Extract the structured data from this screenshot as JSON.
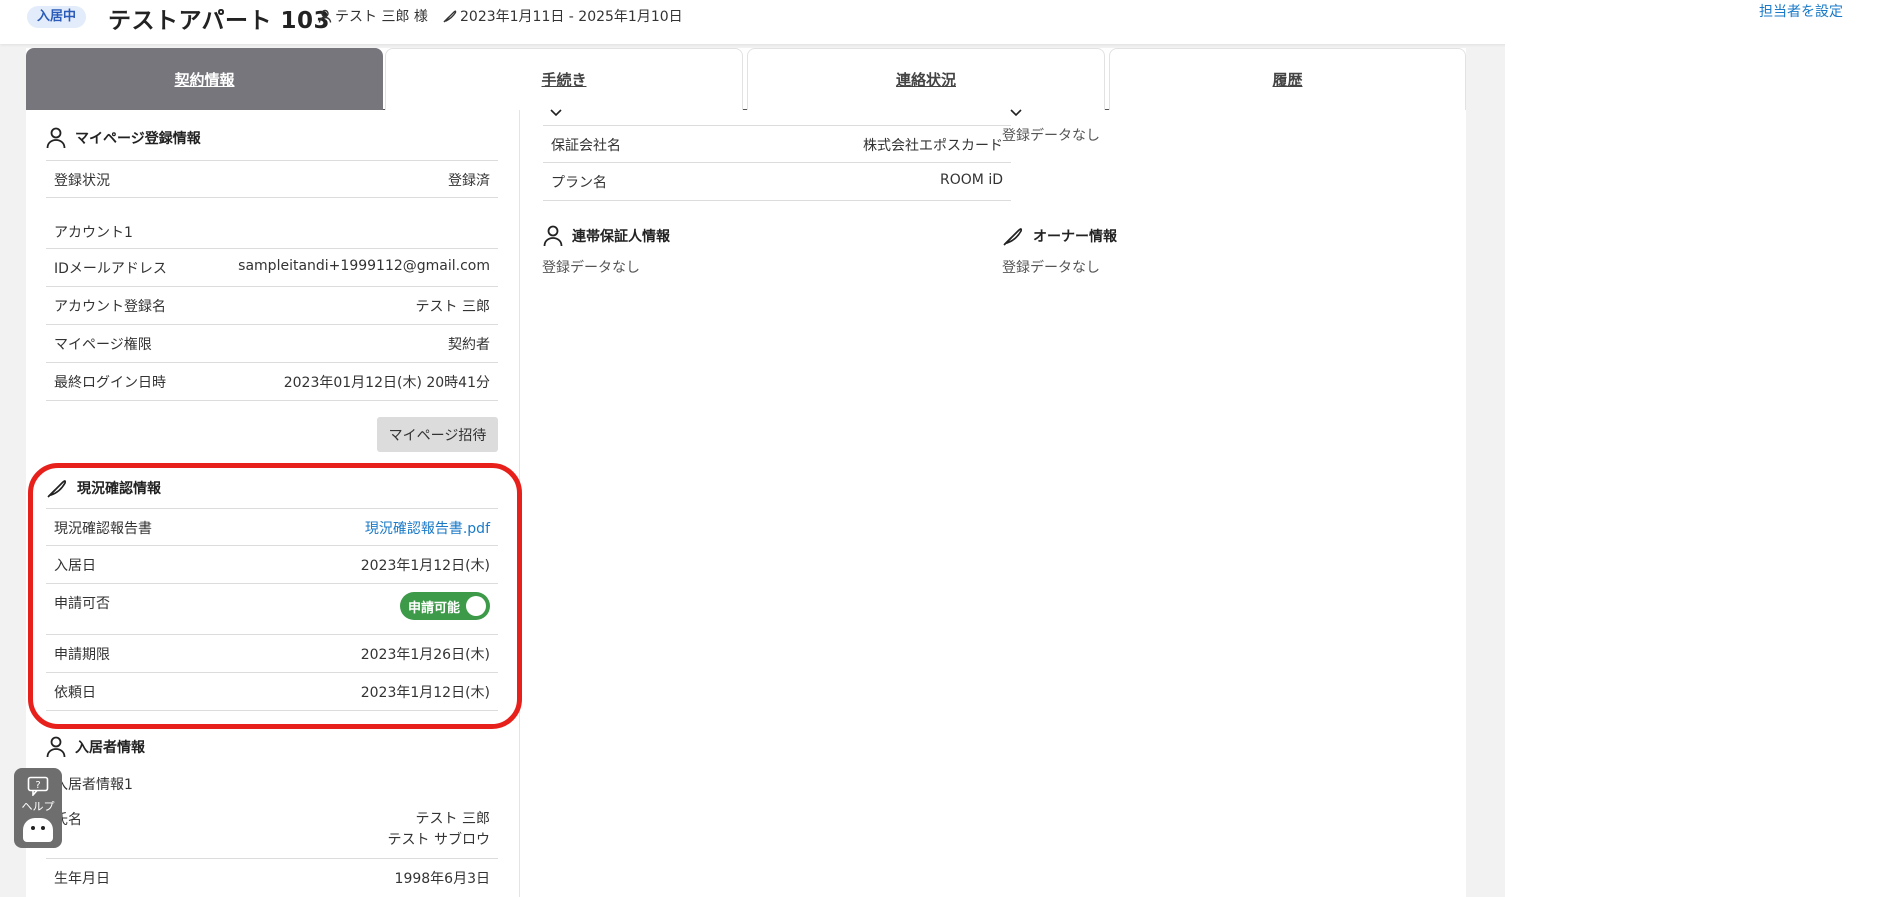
{
  "header": {
    "status_badge": "入居中",
    "property_title": "テストアパート 103",
    "tenant_name": "テスト 三郎 様",
    "contract_period": "2023年1月11日 - 2025年1月10日",
    "assign_link": "担当者を設定"
  },
  "tabs": [
    {
      "label": "契約情報",
      "active": true
    },
    {
      "label": "手続き",
      "active": false
    },
    {
      "label": "連絡状況",
      "active": false
    },
    {
      "label": "履歴",
      "active": false
    }
  ],
  "mypage": {
    "title": "マイページ登録情報",
    "registration_status": {
      "label": "登録状況",
      "value": "登録済"
    },
    "account_heading": "アカウント1",
    "email": {
      "label": "IDメールアドレス",
      "value": "sampleitandi+1999112@gmail.com"
    },
    "account_name": {
      "label": "アカウント登録名",
      "value": "テスト 三郎"
    },
    "permission": {
      "label": "マイページ権限",
      "value": "契約者"
    },
    "last_login": {
      "label": "最終ログイン日時",
      "value": "2023年01月12日(木) 20時41分"
    },
    "invite_button": "マイページ招待"
  },
  "inspection": {
    "title": "現況確認情報",
    "report": {
      "label": "現況確認報告書",
      "value": "現況確認報告書.pdf"
    },
    "move_in_date": {
      "label": "入居日",
      "value": "2023年1月12日(木)"
    },
    "applicable": {
      "label": "申請可否",
      "value": "申請可能",
      "on": true
    },
    "deadline": {
      "label": "申請期限",
      "value": "2023年1月26日(木)"
    },
    "request_date": {
      "label": "依頼日",
      "value": "2023年1月12日(木)"
    }
  },
  "residents": {
    "title": "入居者情報",
    "heading": "入居者情報1",
    "name": {
      "label": "氏名",
      "value": "テスト 三郎",
      "kana": "テスト サブロウ"
    },
    "birthday": {
      "label": "生年月日",
      "value": "1998年6月3日"
    }
  },
  "guarantee": {
    "company": {
      "label": "保証会社名",
      "value": "株式会社エポスカード"
    },
    "plan": {
      "label": "プラン名",
      "value": "ROOM iD"
    }
  },
  "top_right_no_data": "登録データなし",
  "joint_guarantor": {
    "title": "連帯保証人情報",
    "empty": "登録データなし"
  },
  "owner": {
    "title": "オーナー情報",
    "empty": "登録データなし"
  },
  "help": {
    "label": "ヘルプ"
  },
  "colors": {
    "highlight": "#e8201c",
    "toggle_on": "#3c9a48",
    "link": "#1a7ac8",
    "active_tab": "#77767d"
  }
}
